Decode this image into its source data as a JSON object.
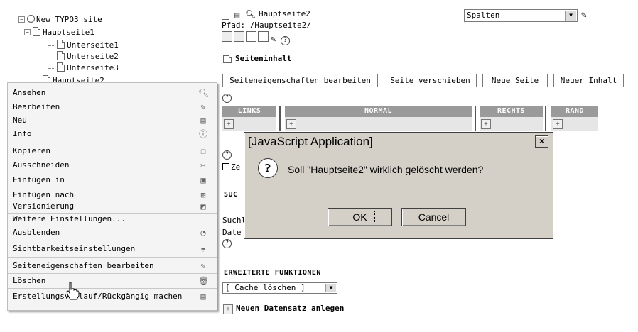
{
  "tree": {
    "root": "New TYPO3 site",
    "page1": "Hauptseite1",
    "sub1": "Unterseite1",
    "sub2": "Unterseite2",
    "sub3": "Unterseite3",
    "page2": "Hauptseite2"
  },
  "context_menu": {
    "items": [
      {
        "label": "Ansehen",
        "icon": "magnifier-icon"
      },
      {
        "label": "Bearbeiten",
        "icon": "pencil-icon"
      },
      {
        "label": "Neu",
        "icon": "new-page-icon"
      },
      {
        "label": "Info",
        "icon": "info-icon"
      },
      {
        "label": "Kopieren",
        "icon": "copy-icon"
      },
      {
        "label": "Ausschneiden",
        "icon": "scissors-icon"
      },
      {
        "label": "Einfügen in",
        "icon": "paste-into-icon"
      },
      {
        "label": "Einfügen nach",
        "icon": "paste-after-icon"
      },
      {
        "label": "Versionierung",
        "icon": "version-icon"
      },
      {
        "label": "Weitere Einstellungen...",
        "icon": ""
      },
      {
        "label": "Ausblenden",
        "icon": "hide-icon"
      },
      {
        "label": "Sichtbarkeitseinstellungen",
        "icon": "visibility-icon"
      },
      {
        "label": "Seiteneigenschaften bearbeiten",
        "icon": "pencil-icon"
      },
      {
        "label": "Löschen",
        "icon": "trash-icon"
      },
      {
        "label": "Erstellungsverlauf/Rückgängig machen",
        "icon": "history-icon"
      }
    ]
  },
  "header": {
    "page_title": "Hauptseite2",
    "path_label": "Pfad: /Hauptseite2/",
    "view_select": "Spalten"
  },
  "content": {
    "section_label": "Seiteninhalt",
    "buttons": [
      "Seiteneigenschaften bearbeiten",
      "Seite verschieben",
      "Neue Seite",
      "Neuer Inhalt"
    ],
    "columns": [
      "LINKS",
      "NORMAL",
      "RECHTS",
      "RAND"
    ],
    "checkbox_label": "Ze",
    "search_title": "SUC",
    "search_label": "Suchl",
    "date_label": "Date",
    "advanced_title": "ERWEITERTE FUNKTIONEN",
    "cache_select": "[ Cache löschen ]",
    "new_record": "Neuen Datensatz anlegen"
  },
  "dialog": {
    "title": "[JavaScript Application]",
    "message": "Soll \"Hauptseite2\" wirklich gelöscht werden?",
    "ok": "OK",
    "cancel": "Cancel",
    "close": "×"
  }
}
